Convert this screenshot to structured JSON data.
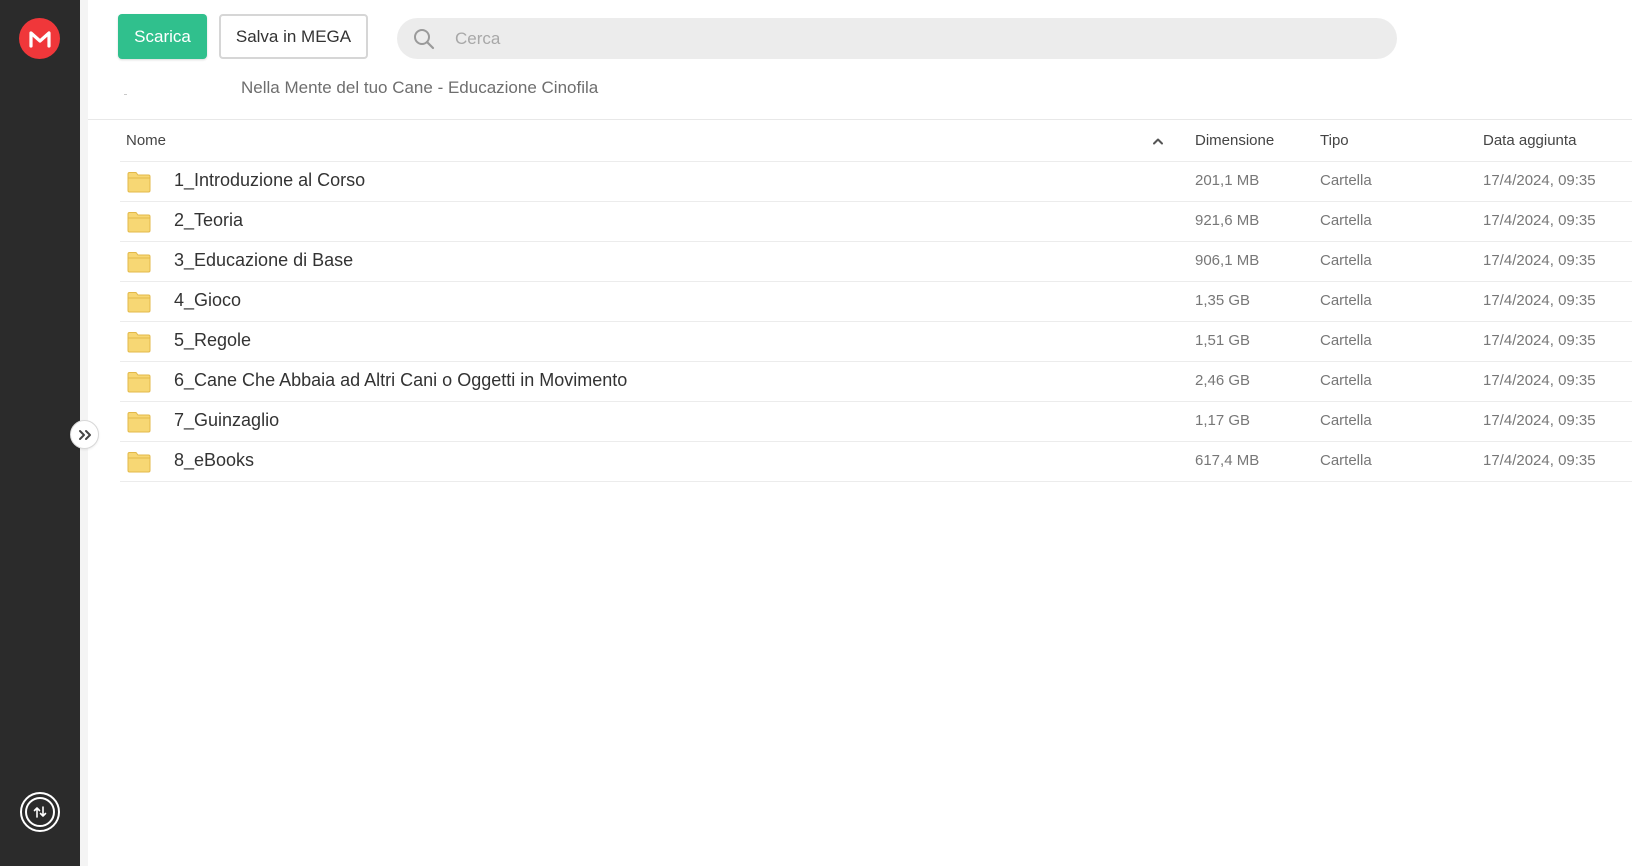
{
  "toolbar": {
    "download_label": "Scarica",
    "save_label": "Salva in MEGA"
  },
  "search": {
    "placeholder": "Cerca"
  },
  "breadcrumb": {
    "title": "Nella Mente del tuo Cane - Educazione Cinofila"
  },
  "columns": {
    "name": "Nome",
    "size": "Dimensione",
    "type": "Tipo",
    "date": "Data aggiunta"
  },
  "rows": [
    {
      "name": "1_Introduzione al Corso",
      "size": "201,1 MB",
      "type": "Cartella",
      "date": "17/4/2024, 09:35"
    },
    {
      "name": "2_Teoria",
      "size": "921,6 MB",
      "type": "Cartella",
      "date": "17/4/2024, 09:35"
    },
    {
      "name": "3_Educazione di Base",
      "size": "906,1 MB",
      "type": "Cartella",
      "date": "17/4/2024, 09:35"
    },
    {
      "name": "4_Gioco",
      "size": "1,35 GB",
      "type": "Cartella",
      "date": "17/4/2024, 09:35"
    },
    {
      "name": "5_Regole",
      "size": "1,51 GB",
      "type": "Cartella",
      "date": "17/4/2024, 09:35"
    },
    {
      "name": "6_Cane Che Abbaia ad Altri Cani o Oggetti in Movimento",
      "size": "2,46 GB",
      "type": "Cartella",
      "date": "17/4/2024, 09:35"
    },
    {
      "name": "7_Guinzaglio",
      "size": "1,17 GB",
      "type": "Cartella",
      "date": "17/4/2024, 09:35"
    },
    {
      "name": "8_eBooks",
      "size": "617,4 MB",
      "type": "Cartella",
      "date": "17/4/2024, 09:35"
    }
  ],
  "icons": {
    "logo": "mega-logo-icon",
    "transfers": "transfer-icon",
    "expand": "chevron-double-right-icon",
    "search": "search-icon",
    "sort": "chevron-up-icon",
    "folder": "folder-icon"
  },
  "colors": {
    "brand": "#f0373a",
    "download": "#30c08d",
    "sidebar": "#2b2b2b",
    "folder": "#f7d774"
  }
}
